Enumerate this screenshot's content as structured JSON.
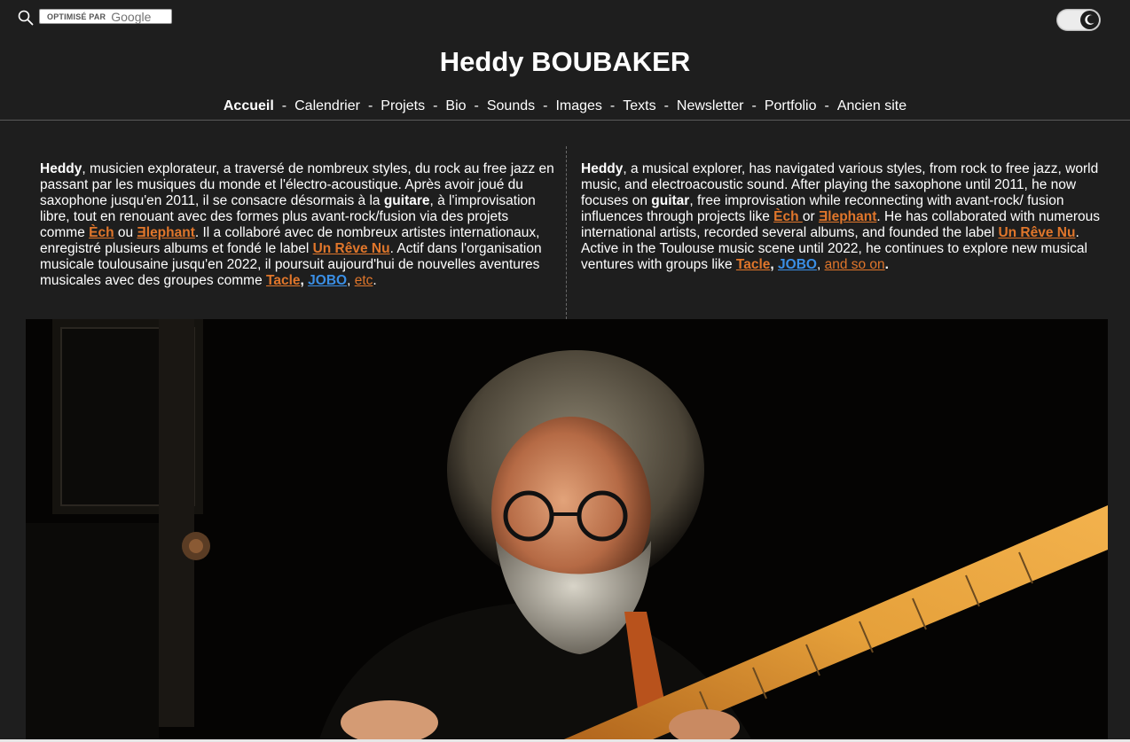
{
  "search": {
    "powered_by": "OPTIMISÉ PAR",
    "google": "Google"
  },
  "site": {
    "title": "Heddy BOUBAKER"
  },
  "nav": {
    "items": [
      {
        "label": "Accueil",
        "active": true
      },
      {
        "label": "Calendrier"
      },
      {
        "label": "Projets"
      },
      {
        "label": "Bio"
      },
      {
        "label": "Sounds"
      },
      {
        "label": "Images"
      },
      {
        "label": "Texts"
      },
      {
        "label": "Newsletter"
      },
      {
        "label": "Portfolio"
      },
      {
        "label": "Ancien site"
      }
    ],
    "separator": "-"
  },
  "bio_fr": {
    "name": "Heddy",
    "t1": ", musicien explorateur, a traversé de nombreux styles, du rock au free jazz en passant par les musiques du monde et l'électro-acoustique. Après avoir joué du saxophone jusqu'en 2011, il se consacre désormais à la ",
    "guitar": "guitare",
    "t2": ", à l'improvisation libre, tout en renouant avec des formes plus avant-rock/fusion via des projets comme ",
    "link_ech": "Èch",
    "t3": " ou ",
    "link_elephant": "Ǝlephant",
    "t4": ". Il a collaboré avec de nombreux artistes internationaux, enregistré plusieurs albums et fondé le label ",
    "link_label": "Un Rêve Nu",
    "t5": ". Actif dans l'organisation musicale toulousaine jusqu'en 2022, il poursuit aujourd'hui de nouvelles aventures musicales avec des groupes comme ",
    "link_tacle": "Tacle",
    "comma": ",",
    "link_jobo": "JOBO",
    "t6": ", ",
    "link_etc": "etc",
    "end": "."
  },
  "bio_en": {
    "name": "Heddy",
    "t1": ", a musical explorer, has navigated various styles, from rock to free jazz, world music, and electroacoustic sound. After playing the saxophone until 2011, he now focuses on ",
    "guitar": "guitar",
    "t2": ", free improvisation while reconnecting with avant-rock/ fusion influences through projects like ",
    "link_ech": "Èch ",
    "t3": "or ",
    "link_elephant": "Ǝlephant",
    "t4": ". He has collaborated with numerous international artists, recorded several albums, and founded the label ",
    "link_label": "Un Rêve Nu",
    "t5": ". Active in the Toulouse music scene until 2022, he continues to explore new musical ventures with groups like ",
    "link_tacle": "Tacle",
    "comma": ", ",
    "link_jobo": "JOBO",
    "t6": ", ",
    "link_andso": "and so on",
    "end": "."
  },
  "colors": {
    "background": "#1e1e1e",
    "link_orange": "#e0762b",
    "link_blue": "#3a8fe6"
  },
  "icons": {
    "search": "search-icon",
    "theme_toggle": "moon-icon"
  }
}
